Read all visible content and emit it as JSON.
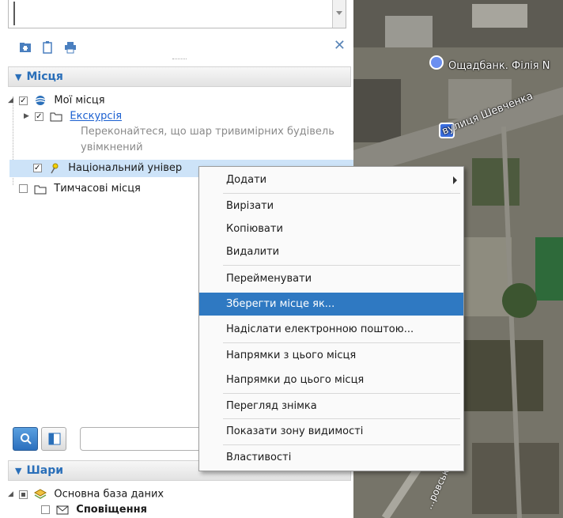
{
  "places_panel": {
    "header": "Місця",
    "tree": {
      "my_places": "Мої місця",
      "excursion": "Екскурсія",
      "excursion_desc_1": "Переконайтеся, що шар тривимірних будівель",
      "excursion_desc_2": "увімкнений",
      "university": "Національний універ",
      "university_tail": "...",
      "temp_places": "Тимчасові місця"
    }
  },
  "layers_panel": {
    "header": "Шари",
    "items": [
      "Основна база даних",
      "Сповіщення"
    ]
  },
  "context_menu": {
    "items": [
      {
        "label": "Додати",
        "submenu": true
      },
      {
        "label": "Вирізати"
      },
      {
        "label": "Копіювати"
      },
      {
        "label": "Видалити"
      },
      {
        "label": "Перейменувати"
      },
      {
        "label": "Зберегти місце як...",
        "highlighted": true
      },
      {
        "label": "Надіслати електронною поштою..."
      },
      {
        "label": "Напрямки з цього місця"
      },
      {
        "label": "Напрямки до цього місця"
      },
      {
        "label": "Перегляд знімка"
      },
      {
        "label": "Показати зону видимості"
      },
      {
        "label": "Властивості"
      }
    ]
  },
  "map": {
    "bank_label": "Ощадбанк. Філія N",
    "street_label": "вулиця Шевченка",
    "street_label_2": "...ровсько..."
  },
  "colors": {
    "accent": "#2a6fb9",
    "menu_highlight": "#2f79c2",
    "selection": "#cde3f8"
  }
}
